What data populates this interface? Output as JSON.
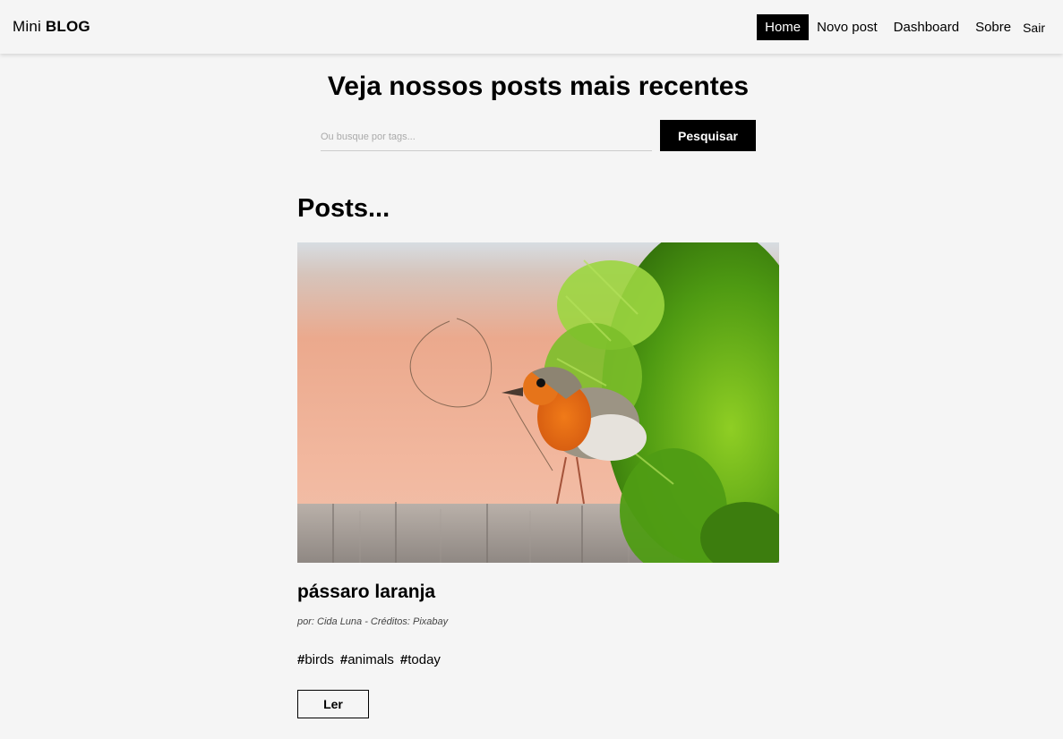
{
  "navbar": {
    "brand_light": "Mini",
    "brand_bold": "BLOG",
    "links": [
      {
        "label": "Home",
        "active": true
      },
      {
        "label": "Novo post",
        "active": false
      },
      {
        "label": "Dashboard",
        "active": false
      },
      {
        "label": "Sobre",
        "active": false
      }
    ],
    "logout_label": "Sair"
  },
  "hero": {
    "title": "Veja nossos posts mais recentes",
    "search_placeholder": "Ou busque por tags...",
    "search_button": "Pesquisar"
  },
  "posts_section": {
    "title": "Posts..."
  },
  "post": {
    "image_subject": "robin-bird-photo",
    "title": "pássaro laranja",
    "meta": "por: Cida Luna - Créditos: Pixabay",
    "tags": [
      "birds",
      "animals",
      "today"
    ],
    "read_button": "Ler"
  },
  "colors": {
    "background": "#f5f5f5",
    "primary": "#000000",
    "on_primary": "#ffffff"
  }
}
